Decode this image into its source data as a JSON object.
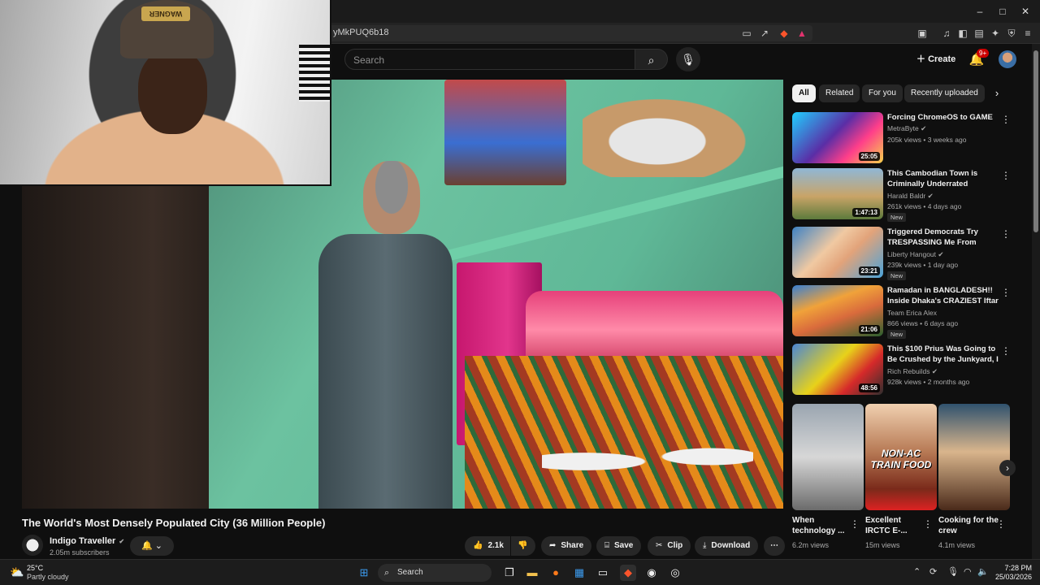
{
  "browser": {
    "url_fragment": "yMkPUQ6b18",
    "window_controls": {
      "minimize": "–",
      "maximize": "□",
      "close": "✕"
    }
  },
  "header": {
    "search_placeholder": "Search",
    "create_label": "Create",
    "notification_count": "9+"
  },
  "webcam": {
    "hat_text": "WAGNER"
  },
  "video": {
    "title": "The World's Most Densely Populated City (36 Million People)",
    "channel_name": "Indigo Traveller",
    "subscribers": "2.05m subscribers",
    "like_count": "2.1k",
    "share_label": "Share",
    "save_label": "Save",
    "clip_label": "Clip",
    "download_label": "Download"
  },
  "sidebar": {
    "chips": [
      {
        "label": "All"
      },
      {
        "label": "Related"
      },
      {
        "label": "For you"
      },
      {
        "label": "Recently uploaded"
      }
    ],
    "recommendations": [
      {
        "title": "Forcing ChromeOS to GAME",
        "channel": "MetraByte",
        "meta": "205k views • 3 weeks ago",
        "duration": "25:05",
        "new": ""
      },
      {
        "title": "This Cambodian Town is Criminally Underrated",
        "channel": "Harald Baldr",
        "meta": "261k views • 4 days ago",
        "duration": "1:47:13",
        "new": "New"
      },
      {
        "title": "Triggered Democrats Try TRESPASSING Me From Publi...",
        "channel": "Liberty Hangout",
        "meta": "239k views • 1 day ago",
        "duration": "23:21",
        "new": "New"
      },
      {
        "title": "Ramadan in BANGLADESH!! Inside Dhaka's CRAZIEST Iftar ...",
        "channel": "Team Erica Alex",
        "meta": "866 views • 6 days ago",
        "duration": "21:06",
        "new": "New"
      },
      {
        "title": "This $100 Prius Was Going to Be Crushed by the Junkyard, I ...",
        "channel": "Rich Rebuilds",
        "meta": "928k views • 2 months ago",
        "duration": "48:56",
        "new": ""
      }
    ],
    "shorts": [
      {
        "title": "When technology ...",
        "views": "6.2m views",
        "overlay": ""
      },
      {
        "title": "Excellent IRCTC E-...",
        "views": "15m views",
        "overlay": "NON-AC TRAIN FOOD"
      },
      {
        "title": "Cooking for the crew",
        "views": "4.1m views",
        "overlay": ""
      }
    ]
  },
  "taskbar": {
    "temperature": "25°C",
    "weather": "Partly cloudy",
    "search_label": "Search",
    "time": "7:28 PM",
    "date": "25/03/2026"
  }
}
